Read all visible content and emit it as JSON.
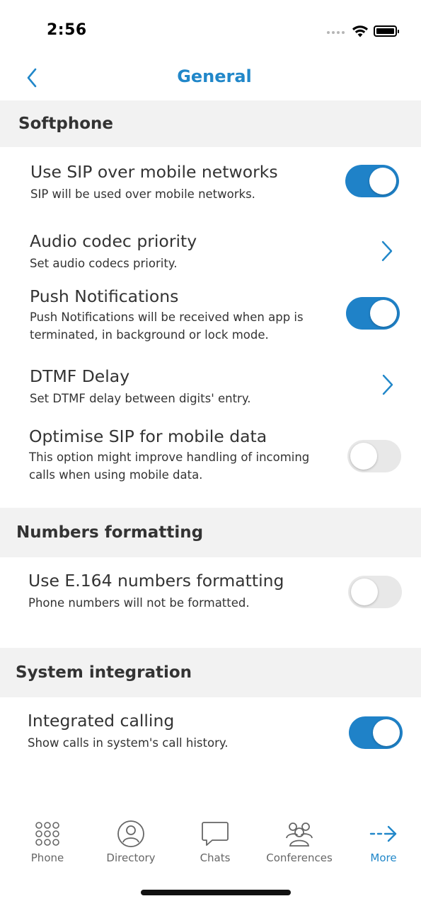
{
  "status_bar": {
    "time": "2:56"
  },
  "nav": {
    "title": "General",
    "back_icon": "chevron-left-icon"
  },
  "sections": [
    {
      "title": "Softphone",
      "items": [
        {
          "title": "Use SIP over mobile networks",
          "subtitle": "SIP will be used over mobile networks.",
          "control": "toggle",
          "value": true
        },
        {
          "title": "Audio codec priority",
          "subtitle": "Set audio codecs priority.",
          "control": "chevron"
        },
        {
          "title": "Push Notifications",
          "subtitle": "Push Notifications will be received when app is terminated, in background or lock mode.",
          "control": "toggle",
          "value": true
        },
        {
          "title": "DTMF Delay",
          "subtitle": "Set DTMF delay between digits' entry.",
          "control": "chevron"
        },
        {
          "title": "Optimise SIP for mobile data",
          "subtitle": "This option might improve handling of incoming calls when using mobile data.",
          "control": "toggle",
          "value": false
        }
      ]
    },
    {
      "title": "Numbers formatting",
      "items": [
        {
          "title": "Use E.164 numbers formatting",
          "subtitle": "Phone numbers will not be formatted.",
          "control": "toggle",
          "value": false
        }
      ]
    },
    {
      "title": "System integration",
      "items": [
        {
          "title": "Integrated calling",
          "subtitle": "Show calls in system's call history.",
          "control": "toggle",
          "value": true
        }
      ]
    }
  ],
  "tab_bar": {
    "tabs": [
      {
        "label": "Phone",
        "icon": "dialpad-icon",
        "active": false
      },
      {
        "label": "Directory",
        "icon": "person-icon",
        "active": false
      },
      {
        "label": "Chats",
        "icon": "chat-bubble-icon",
        "active": false
      },
      {
        "label": "Conferences",
        "icon": "group-icon",
        "active": false
      },
      {
        "label": "More",
        "icon": "arrow-right-icon",
        "active": true
      }
    ]
  },
  "colors": {
    "accent": "#2187c9",
    "toggle_on": "#1f82c8",
    "toggle_off": "#e8e8e8",
    "section_bg": "#f2f2f2"
  }
}
